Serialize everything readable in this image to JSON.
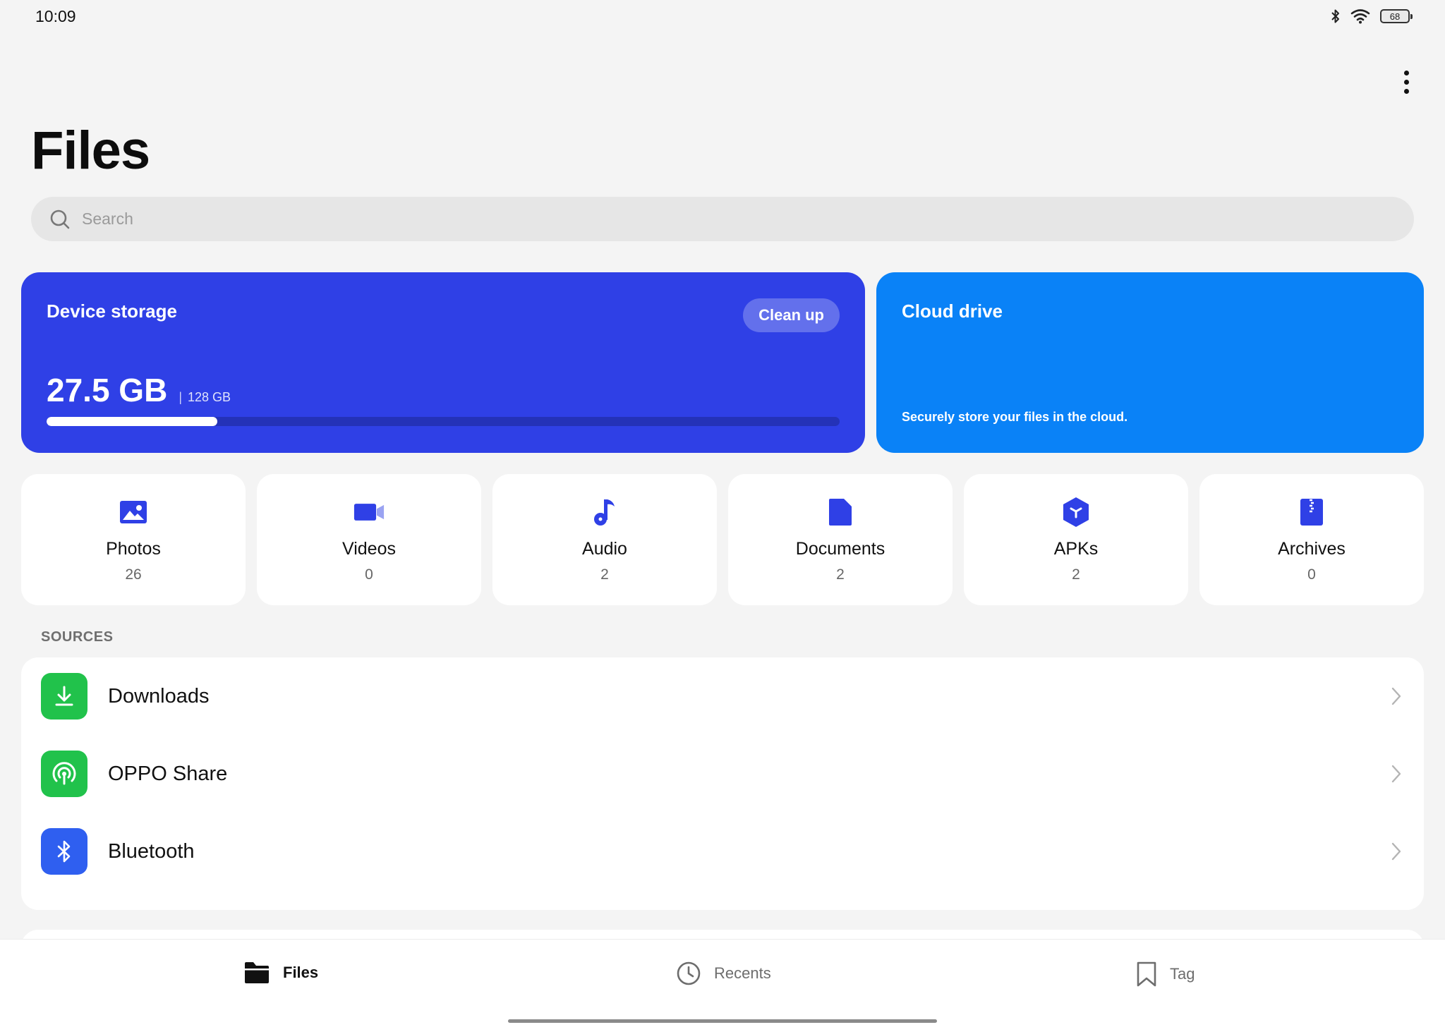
{
  "status": {
    "time": "10:09",
    "battery": "68",
    "icons": [
      "bluetooth-icon",
      "wifi-icon",
      "battery-icon"
    ]
  },
  "header": {
    "title": "Files",
    "menu_icon": "more-vertical-icon"
  },
  "search": {
    "placeholder": "Search",
    "icon": "search-icon"
  },
  "storage": {
    "title": "Device storage",
    "cleanup_label": "Clean up",
    "used": "27.5 GB",
    "separator": "|",
    "total": "128 GB",
    "used_fraction": 0.215,
    "colors": {
      "card": "#2f40e6",
      "track": "#2432b8",
      "fill": "#ffffff"
    }
  },
  "cloud": {
    "title": "Cloud drive",
    "subtitle": "Securely store your files in the cloud.",
    "color": "#0a82f7"
  },
  "categories": [
    {
      "label": "Photos",
      "count": "26",
      "icon": "photos-icon"
    },
    {
      "label": "Videos",
      "count": "0",
      "icon": "videos-icon"
    },
    {
      "label": "Audio",
      "count": "2",
      "icon": "audio-icon"
    },
    {
      "label": "Documents",
      "count": "2",
      "icon": "documents-icon"
    },
    {
      "label": "APKs",
      "count": "2",
      "icon": "apks-icon"
    },
    {
      "label": "Archives",
      "count": "0",
      "icon": "archives-icon"
    }
  ],
  "category_icon_color": "#2f40e6",
  "sources": {
    "heading": "SOURCES",
    "items": [
      {
        "label": "Downloads",
        "icon": "download-icon",
        "color": "#21c24b"
      },
      {
        "label": "OPPO Share",
        "icon": "oppo-share-icon",
        "color": "#21c24b"
      },
      {
        "label": "Bluetooth",
        "icon": "bluetooth-icon",
        "color": "#2f5ff0"
      }
    ]
  },
  "bottom_nav": {
    "items": [
      {
        "label": "Files",
        "icon": "folder-icon",
        "active": true
      },
      {
        "label": "Recents",
        "icon": "clock-icon",
        "active": false
      },
      {
        "label": "Tag",
        "icon": "bookmark-icon",
        "active": false
      }
    ]
  }
}
